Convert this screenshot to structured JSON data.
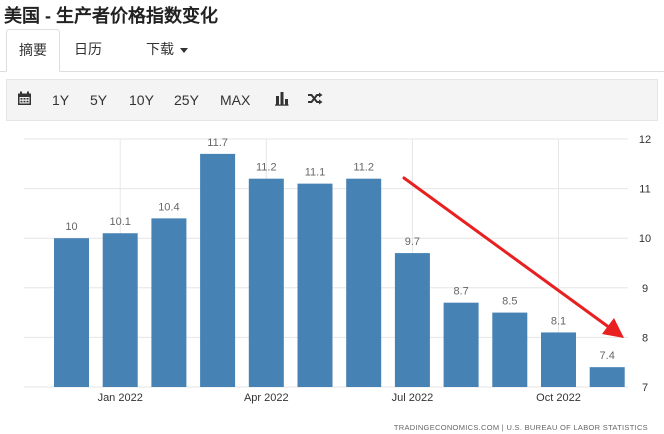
{
  "page": {
    "title": "美国 - 生产者价格指数变化"
  },
  "tabs": [
    {
      "label": "摘要"
    },
    {
      "label": "日历"
    },
    {
      "label": "下载"
    }
  ],
  "toolbar": {
    "calendar_icon": "calendar-icon",
    "ranges": [
      "1Y",
      "5Y",
      "10Y",
      "25Y",
      "MAX"
    ],
    "chart_type_icon": "bar-chart-icon",
    "compare_icon": "shuffle-icon"
  },
  "chart_data": {
    "type": "bar",
    "categories": [
      "2021-12",
      "2022-01",
      "2022-02",
      "2022-03",
      "2022-04",
      "2022-05",
      "2022-06",
      "2022-07",
      "2022-08",
      "2022-09",
      "2022-10",
      "2022-11"
    ],
    "values": [
      10,
      10.1,
      10.4,
      11.7,
      11.2,
      11.1,
      11.2,
      9.7,
      8.7,
      8.5,
      8.1,
      7.4
    ],
    "value_labels": [
      "10",
      "10.1",
      "10.4",
      "11.7",
      "11.2",
      "11.1",
      "11.2",
      "9.7",
      "8.7",
      "8.5",
      "8.1",
      "7.4"
    ],
    "x_tick_labels": [
      "Jan 2022",
      "Apr 2022",
      "Jul 2022",
      "Oct 2022"
    ],
    "y_ticks": [
      "7",
      "8",
      "9",
      "10",
      "11",
      "12"
    ],
    "ylim": [
      7,
      12
    ],
    "y_axis_position": "right",
    "grid": true,
    "annotation": "red downward arrow from Jul 2022 toward Nov 2022",
    "source": "TRADINGECONOMICS.COM  |  U.S. BUREAU OF LABOR STATISTICS",
    "colors": {
      "bar": "#4682b4",
      "arrow": "#e82020",
      "grid": "#e6e6e6"
    }
  }
}
